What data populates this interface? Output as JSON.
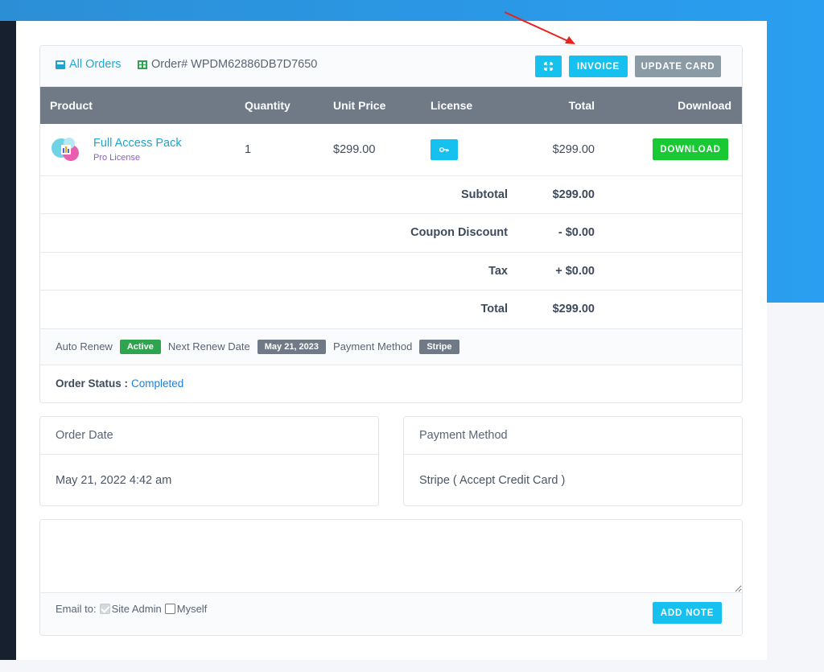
{
  "colors": {
    "accent": "#16c1ef",
    "brand_blue": "#2d9ae8",
    "success": "#19c934",
    "header_gray": "#6f7a86"
  },
  "header": {
    "all_orders": "All Orders",
    "order_id": "Order# WPDM62886DB7D7650",
    "invoice": "INVOICE",
    "update_card": "UPDATE CARD"
  },
  "table": {
    "columns": [
      "Product",
      "Quantity",
      "Unit Price",
      "License",
      "Total",
      "Download"
    ],
    "item": {
      "name": "Full Access Pack",
      "license_name": "Pro License",
      "quantity": "1",
      "unit_price": "$299.00",
      "total": "$299.00",
      "download": "DOWNLOAD"
    },
    "summary": [
      {
        "label": "Subtotal",
        "value": "$299.00"
      },
      {
        "label": "Coupon Discount",
        "value": "- $0.00"
      },
      {
        "label": "Tax",
        "value": "+ $0.00"
      },
      {
        "label": "Total",
        "value": "$299.00"
      }
    ]
  },
  "renew": {
    "auto_renew_label": "Auto Renew",
    "auto_renew_value": "Active",
    "next_date_label": "Next Renew Date",
    "next_date_value": "May 21, 2023",
    "payment_label": "Payment Method",
    "payment_value": "Stripe"
  },
  "status": {
    "label": "Order Status :",
    "value": "Completed"
  },
  "order_date": {
    "title": "Order Date",
    "value": "May 21, 2022 4:42 am"
  },
  "payment_method": {
    "title": "Payment Method",
    "value": "Stripe ( Accept Credit Card )"
  },
  "note": {
    "email_to": "Email to:",
    "site_admin": "Site Admin",
    "myself": "Myself",
    "add_note": "ADD NOTE"
  }
}
